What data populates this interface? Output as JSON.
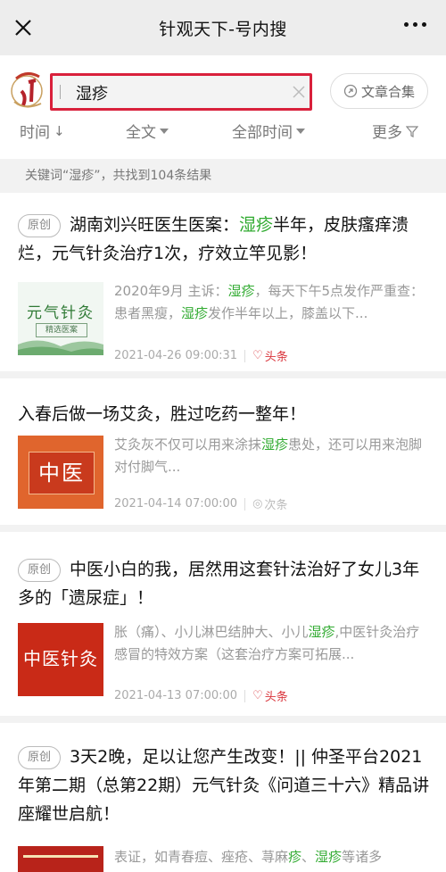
{
  "titlebar": {
    "title": "针观天下-号内搜"
  },
  "search": {
    "query": "湿疹",
    "collection_label": "文章合集"
  },
  "filters": [
    {
      "label": "时间",
      "glyph": "↓"
    },
    {
      "label": "全文"
    },
    {
      "label": "全部时间"
    },
    {
      "label": "更多"
    }
  ],
  "result_summary": "关键词“湿疹”，共找到104条结果",
  "colors": {
    "highlight": "#2faa2f",
    "border_red": "#d9203b",
    "hot": "#d9343b"
  },
  "results": [
    {
      "badge": "原创",
      "title_parts": [
        "湖南刘兴旺医生医案：",
        "湿疹",
        "半年，皮肤瘙痒溃烂，元气针灸治疗1次，疗效立竿见影！"
      ],
      "excerpt_parts": [
        "2020年9月 主诉：",
        "湿疹",
        "，每天下午5点发作严重查：患者黑瘦，",
        "湿疹",
        "发作半年以上，膝盖以下..."
      ],
      "thumb": {
        "line1": "元气针灸",
        "line2": "精选医案"
      },
      "date": "2021-04-26 09:00:31",
      "tag": "头条"
    },
    {
      "title_parts": [
        "入春后做一场艾灸，胜过吃药一整年！"
      ],
      "excerpt_parts": [
        "艾灸灰不仅可以用来涂抹",
        "湿疹",
        "患处，还可以用来泡脚对付脚气..."
      ],
      "thumb": {
        "text": "中医"
      },
      "date": "2021-04-14 07:00:00",
      "tag": "次条"
    },
    {
      "badge": "原创",
      "title_parts": [
        "中医小白的我，居然用这套针法治好了女儿3年多的「遗尿症」！"
      ],
      "excerpt_parts": [
        "胀（痛）、小儿淋巴结肿大、小儿",
        "湿疹",
        ",中医针灸治疗感冒的特效方案（这套治疗方案可拓展..."
      ],
      "thumb": {
        "text": "中医针灸"
      },
      "date": "2021-04-13 07:00:00",
      "tag": "头条"
    },
    {
      "badge": "原创",
      "title_parts": [
        "3天2晚，足以让您产生改变！|| 仲圣平台2021年第二期（总第22期）元气针灸《问道三十六》精品讲座耀世启航！"
      ],
      "excerpt_parts": [
        "表证，如青春痘、痤疮、荨麻",
        "疹",
        "、",
        "湿疹",
        "等诸多"
      ]
    }
  ]
}
